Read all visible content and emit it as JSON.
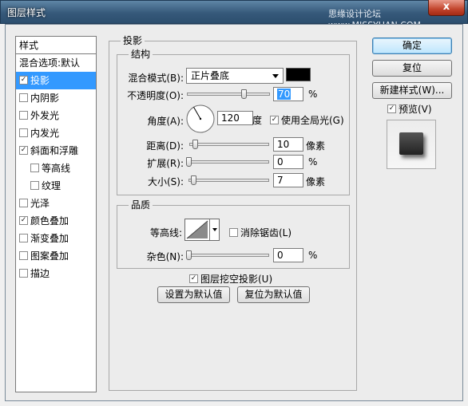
{
  "window": {
    "title": "图层样式",
    "watermark": "思缘设计论坛 www.MISSYUAN.COM",
    "close_glyph": "x"
  },
  "sidebar": {
    "header": "样式",
    "items": [
      {
        "label": "混合选项:默认",
        "checkbox": false,
        "checked": false,
        "selected": false,
        "indent": 0
      },
      {
        "label": "投影",
        "checkbox": true,
        "checked": true,
        "selected": true,
        "indent": 0
      },
      {
        "label": "内阴影",
        "checkbox": true,
        "checked": false,
        "selected": false,
        "indent": 0
      },
      {
        "label": "外发光",
        "checkbox": true,
        "checked": false,
        "selected": false,
        "indent": 0
      },
      {
        "label": "内发光",
        "checkbox": true,
        "checked": false,
        "selected": false,
        "indent": 0
      },
      {
        "label": "斜面和浮雕",
        "checkbox": true,
        "checked": true,
        "selected": false,
        "indent": 0
      },
      {
        "label": "等高线",
        "checkbox": true,
        "checked": false,
        "selected": false,
        "indent": 1
      },
      {
        "label": "纹理",
        "checkbox": true,
        "checked": false,
        "selected": false,
        "indent": 1
      },
      {
        "label": "光泽",
        "checkbox": true,
        "checked": false,
        "selected": false,
        "indent": 0
      },
      {
        "label": "颜色叠加",
        "checkbox": true,
        "checked": true,
        "selected": false,
        "indent": 0
      },
      {
        "label": "渐变叠加",
        "checkbox": true,
        "checked": false,
        "selected": false,
        "indent": 0
      },
      {
        "label": "图案叠加",
        "checkbox": true,
        "checked": false,
        "selected": false,
        "indent": 0
      },
      {
        "label": "描边",
        "checkbox": true,
        "checked": false,
        "selected": false,
        "indent": 0
      }
    ]
  },
  "drop_shadow": {
    "title": "投影",
    "structure": {
      "title": "结构",
      "blend_mode_label": "混合模式(B):",
      "blend_mode_value": "正片叠底",
      "blend_color": "#000000",
      "opacity_label": "不透明度(O):",
      "opacity_value": "70",
      "opacity_unit": "%",
      "opacity_fraction": 0.7,
      "angle_label": "角度(A):",
      "angle_value": "120",
      "angle_unit": "度",
      "global_light_label": "使用全局光(G)",
      "global_light_checked": true,
      "distance_label": "距离(D):",
      "distance_value": "10",
      "distance_unit": "像素",
      "distance_fraction": 0.04,
      "spread_label": "扩展(R):",
      "spread_value": "0",
      "spread_unit": "%",
      "spread_fraction": 0.0,
      "size_label": "大小(S):",
      "size_value": "7",
      "size_unit": "像素",
      "size_fraction": 0.03
    },
    "quality": {
      "title": "品质",
      "contour_label": "等高线:",
      "anti_alias_label": "消除锯齿(L)",
      "anti_alias_checked": false,
      "noise_label": "杂色(N):",
      "noise_value": "0",
      "noise_unit": "%",
      "noise_fraction": 0.0
    },
    "knockout_label": "图层挖空投影(U)",
    "knockout_checked": true,
    "make_default_label": "设置为默认值",
    "reset_default_label": "复位为默认值"
  },
  "buttons": {
    "ok": "确定",
    "reset": "复位",
    "new_style": "新建样式(W)...",
    "preview_label": "预览(V)",
    "preview_checked": true
  }
}
